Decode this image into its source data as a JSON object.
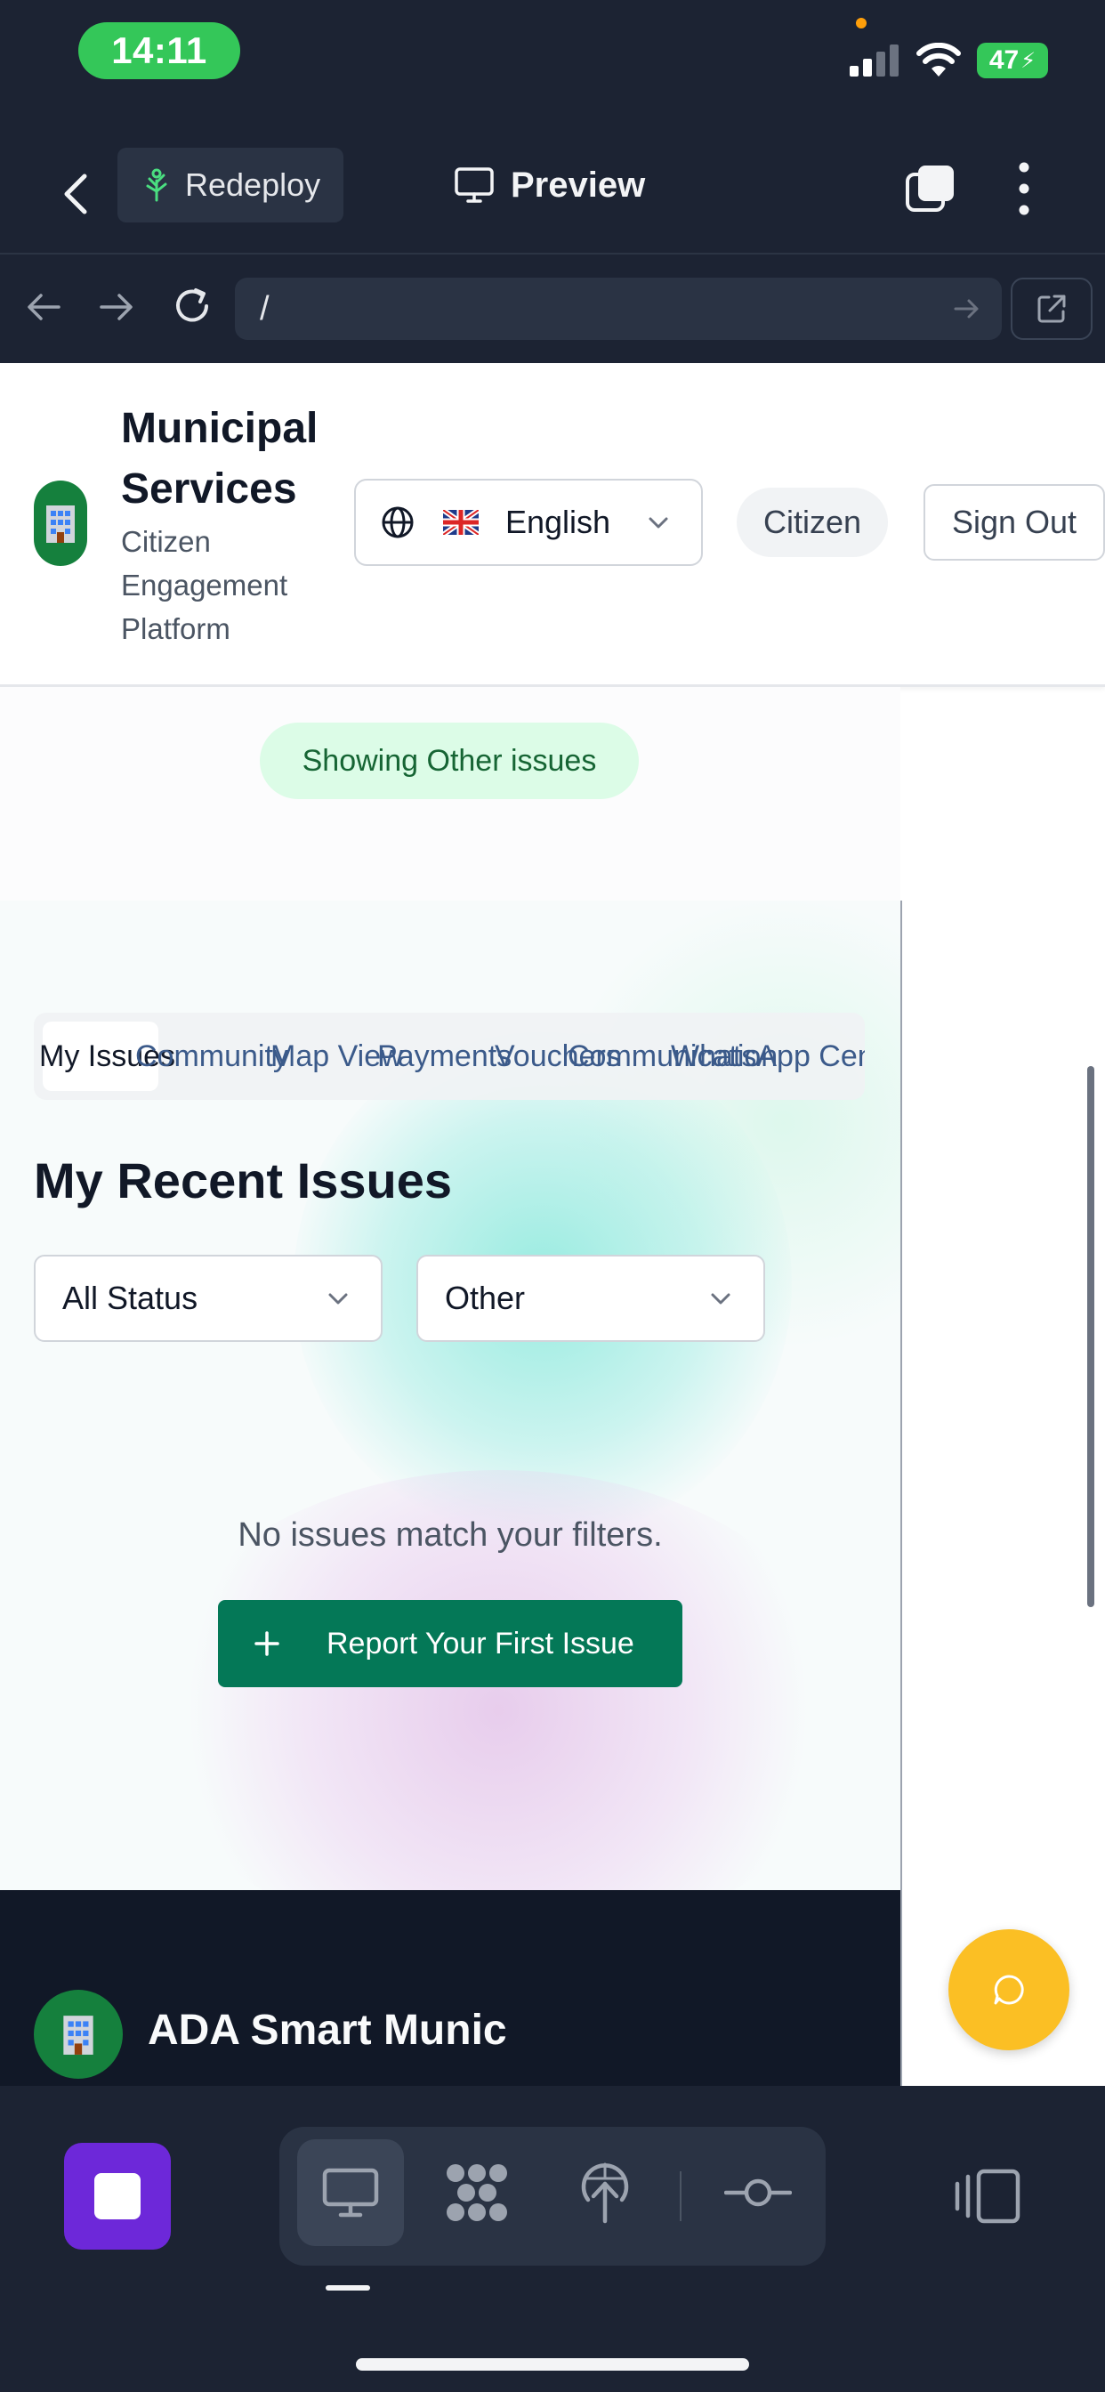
{
  "status_bar": {
    "time": "14:11",
    "battery": "47"
  },
  "app_toolbar": {
    "redeploy_label": "Redeploy",
    "preview_label": "Preview"
  },
  "browser": {
    "url": "/"
  },
  "site_header": {
    "brand_title": "Municipal Services",
    "brand_subtitle": "Citizen Engagement Platform",
    "language": "English",
    "role": "Citizen",
    "sign_out": "Sign Out"
  },
  "filter_pill": "Showing Other issues",
  "tabs": [
    {
      "label": "My Issues",
      "active": true
    },
    {
      "label": "Community",
      "active": false
    },
    {
      "label": "Map View",
      "active": false
    },
    {
      "label": "Payments",
      "active": false
    },
    {
      "label": "Vouchers",
      "active": false
    },
    {
      "label": "Communication",
      "active": false
    },
    {
      "label": "WhatsApp Center",
      "active": false
    }
  ],
  "section_title": "My Recent Issues",
  "filters": {
    "status": "All Status",
    "category": "Other"
  },
  "empty_message": "No issues match your filters.",
  "report_button": "Report Your First Issue",
  "footer": {
    "title": "ADA Smart Munic"
  },
  "colors": {
    "brand_green": "#047857",
    "pill_bg": "#dcfce7",
    "chat_fab": "#fbbf24",
    "stop_button": "#6d28d9"
  },
  "icons": {
    "logo": "building-icon",
    "language": "globe-icon",
    "flag": "uk-flag-icon",
    "chat": "chat-bubble-icon"
  }
}
